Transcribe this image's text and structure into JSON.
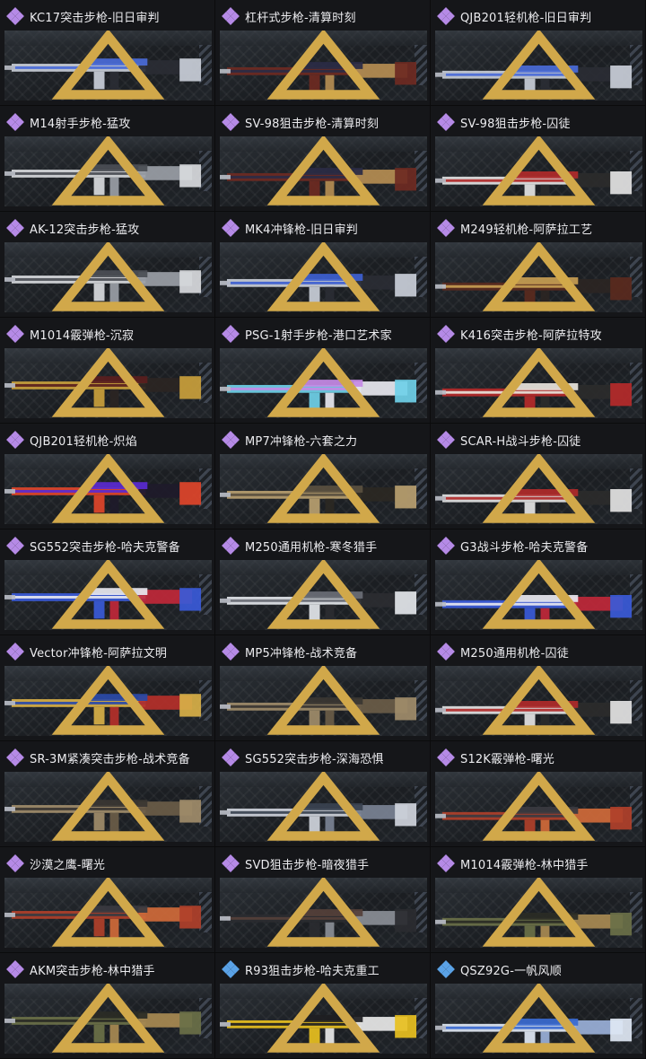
{
  "colors": {
    "legendary": "#b58ae6",
    "epic": "#5aa2e6",
    "background": "#111214",
    "tag": "#d1a84a"
  },
  "items": [
    {
      "name": "KC17突击步枪-旧日审判",
      "rarity": "legendary",
      "palette": [
        "#c9ced8",
        "#4a6bd8",
        "#2a2d34"
      ]
    },
    {
      "name": "杠杆式步枪-清算时刻",
      "rarity": "legendary",
      "palette": [
        "#6e2a22",
        "#2a2b45",
        "#b58d52"
      ]
    },
    {
      "name": "QJB201轻机枪-旧日审判",
      "rarity": "legendary",
      "palette": [
        "#c9ced8",
        "#4a6bd8",
        "#2a2d34"
      ]
    },
    {
      "name": "M14射手步枪-猛攻",
      "rarity": "legendary",
      "palette": [
        "#d8dadd",
        "#4b4e55",
        "#9a9ea6"
      ]
    },
    {
      "name": "SV-98狙击步枪-清算时刻",
      "rarity": "legendary",
      "palette": [
        "#6e2a22",
        "#2a2b45",
        "#b58d52"
      ]
    },
    {
      "name": "SV-98狙击步枪-囚徒",
      "rarity": "legendary",
      "palette": [
        "#e3e3e3",
        "#b02a2a",
        "#2b2b2b"
      ]
    },
    {
      "name": "AK-12突击步枪-猛攻",
      "rarity": "legendary",
      "palette": [
        "#d8dadd",
        "#4b4e55",
        "#9a9ea6"
      ]
    },
    {
      "name": "MK4冲锋枪-旧日审判",
      "rarity": "legendary",
      "palette": [
        "#c9ced8",
        "#3d5fd0",
        "#2a2d34"
      ]
    },
    {
      "name": "M249轻机枪-阿萨拉工艺",
      "rarity": "legendary",
      "palette": [
        "#5a2a1e",
        "#c79d52",
        "#2b2523"
      ]
    },
    {
      "name": "M1014霰弹枪-沉寂",
      "rarity": "legendary",
      "palette": [
        "#c9a03c",
        "#5a1e1e",
        "#2b2523"
      ]
    },
    {
      "name": "PSG-1射手步枪-港口艺术家",
      "rarity": "legendary",
      "palette": [
        "#6fd0e8",
        "#c58ae6",
        "#e8e8f0"
      ]
    },
    {
      "name": "K416突击步枪-阿萨拉特攻",
      "rarity": "legendary",
      "palette": [
        "#b52a2a",
        "#e8e4dc",
        "#2b2b2b"
      ]
    },
    {
      "name": "QJB201轻机枪-炽焰",
      "rarity": "legendary",
      "palette": [
        "#e0452a",
        "#5a2ad0",
        "#1e1a2a"
      ]
    },
    {
      "name": "MP7冲锋枪-六套之力",
      "rarity": "legendary",
      "palette": [
        "#b9a070",
        "#5a5040",
        "#2b2823"
      ]
    },
    {
      "name": "SCAR-H战斗步枪-囚徒",
      "rarity": "legendary",
      "palette": [
        "#e3e3e3",
        "#b02a2a",
        "#2b2b2b"
      ]
    },
    {
      "name": "SG552突击步枪-哈夫克警备",
      "rarity": "legendary",
      "palette": [
        "#3a5ad8",
        "#e8e8f0",
        "#c0283a"
      ]
    },
    {
      "name": "M250通用机枪-寒冬猎手",
      "rarity": "legendary",
      "palette": [
        "#e3e6ea",
        "#6a6e76",
        "#2b2d31"
      ]
    },
    {
      "name": "G3战斗步枪-哈夫克警备",
      "rarity": "legendary",
      "palette": [
        "#3a5ad8",
        "#e8e8f0",
        "#c0283a"
      ]
    },
    {
      "name": "Vector冲锋枪-阿萨拉文明",
      "rarity": "legendary",
      "palette": [
        "#d8b048",
        "#2a4aa8",
        "#b5302a"
      ]
    },
    {
      "name": "MP5冲锋枪-战术竞备",
      "rarity": "legendary",
      "palette": [
        "#a08c6a",
        "#3a3632",
        "#6a5c48"
      ]
    },
    {
      "name": "M250通用机枪-囚徒",
      "rarity": "legendary",
      "palette": [
        "#e3e3e3",
        "#b02a2a",
        "#2b2b2b"
      ]
    },
    {
      "name": "SR-3M紧凑突击步枪-战术竞备",
      "rarity": "legendary",
      "palette": [
        "#a08c6a",
        "#3a3632",
        "#6a5c48"
      ]
    },
    {
      "name": "SG552突击步枪-深海恐惧",
      "rarity": "legendary",
      "palette": [
        "#cfd4dc",
        "#3a4250",
        "#7a8294"
      ]
    },
    {
      "name": "S12K霰弹枪-曙光",
      "rarity": "legendary",
      "palette": [
        "#b0402a",
        "#3a3a40",
        "#d06a3a"
      ]
    },
    {
      "name": "沙漠之鹰-曙光",
      "rarity": "legendary",
      "palette": [
        "#b0402a",
        "#3a3a40",
        "#d06a3a"
      ]
    },
    {
      "name": "SVD狙击步枪-暗夜猎手",
      "rarity": "legendary",
      "palette": [
        "#2a2b30",
        "#55403a",
        "#8a8e96"
      ]
    },
    {
      "name": "M1014霰弹枪-林中猎手",
      "rarity": "legendary",
      "palette": [
        "#6a7048",
        "#2a2b25",
        "#a88a52"
      ]
    },
    {
      "name": "AKM突击步枪-林中猎手",
      "rarity": "legendary",
      "palette": [
        "#6a7048",
        "#2a2b25",
        "#a88a52"
      ]
    },
    {
      "name": "R93狙击步枪-哈夫克重工",
      "rarity": "epic",
      "palette": [
        "#e8c020",
        "#1e1e22",
        "#e8e8e8"
      ]
    },
    {
      "name": "QSZ92G-一帆风顺",
      "rarity": "epic",
      "palette": [
        "#dfe8f4",
        "#3a6ad0",
        "#9ab0d8"
      ]
    }
  ]
}
